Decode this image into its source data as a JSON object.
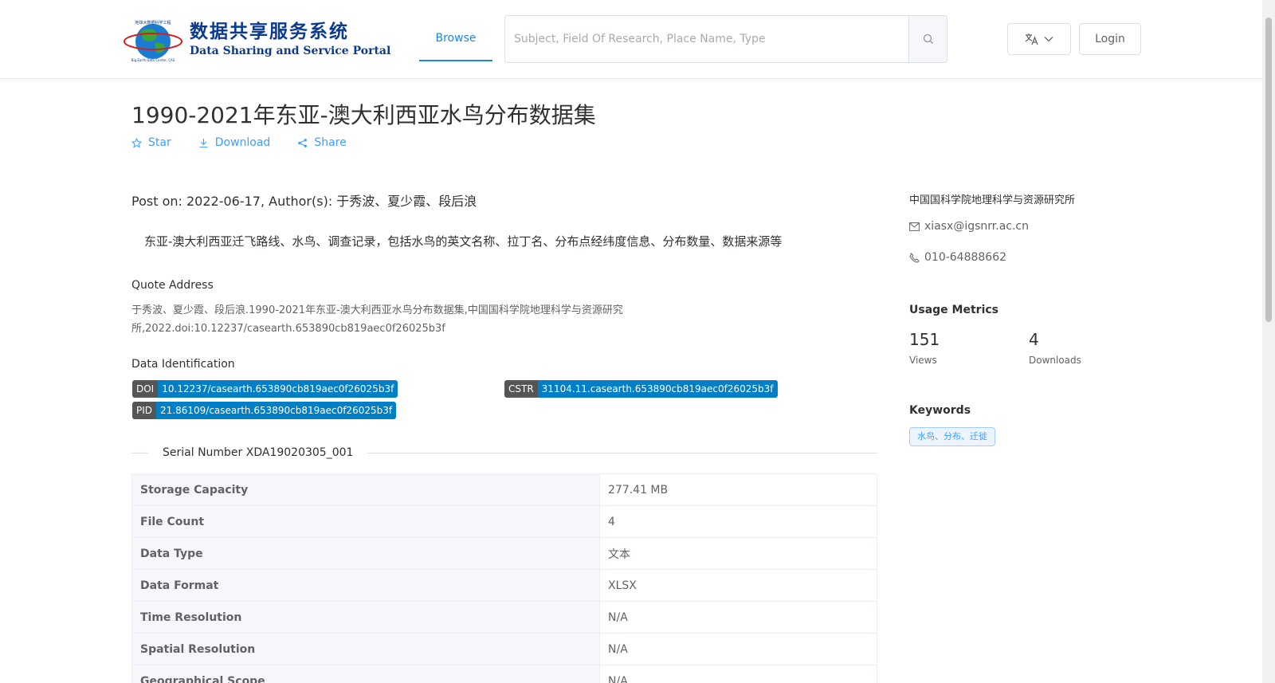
{
  "header": {
    "logo_cn": "数据共享服务系统",
    "logo_en": "Data Sharing and Service Portal",
    "nav_browse": "Browse",
    "search_placeholder": "Subject, Field Of Research, Place Name, Type",
    "login_label": "Login"
  },
  "dataset": {
    "title": "1990-2021年东亚-澳大利西亚水鸟分布数据集",
    "actions": {
      "star": "Star",
      "download": "Download",
      "share": "Share"
    },
    "post_on": "Post on: 2022-06-17, Author(s): 于秀波、夏少霞、段后浪",
    "description": "东亚-澳大利西亚迁飞路线、水鸟、调查记录，包括水鸟的英文名称、拉丁名、分布点经纬度信息、分布数量、数据来源等",
    "quote_label": "Quote Address",
    "quote_text": "于秀波、夏少霞、段后浪.1990-2021年东亚-澳大利西亚水鸟分布数据集,中国国科学院地理科学与资源研究所,2022.doi:10.12237/casearth.653890cb819aec0f26025b3f",
    "identification_label": "Data Identification",
    "identifiers": {
      "doi_key": "DOI",
      "doi_val": "10.12237/casearth.653890cb819aec0f26025b3f",
      "cstr_key": "CSTR",
      "cstr_val": "31104.11.casearth.653890cb819aec0f26025b3f",
      "pid_key": "PID",
      "pid_val": "21.86109/casearth.653890cb819aec0f26025b3f"
    },
    "serial_number": "Serial Number XDA19020305_001",
    "table": [
      {
        "key": "Storage Capacity",
        "value": "277.41 MB"
      },
      {
        "key": "File Count",
        "value": "4"
      },
      {
        "key": "Data Type",
        "value": "文本"
      },
      {
        "key": "Data Format",
        "value": "XLSX"
      },
      {
        "key": "Time Resolution",
        "value": "N/A"
      },
      {
        "key": "Spatial Resolution",
        "value": "N/A"
      },
      {
        "key": "Geographical Scope",
        "value": "N/A"
      }
    ]
  },
  "sidebar": {
    "organization": "中国国科学院地理科学与资源研究所",
    "email": "xiasx@igsnrr.ac.cn",
    "phone": "010-64888662",
    "usage_heading": "Usage Metrics",
    "views_count": "151",
    "views_label": "Views",
    "downloads_count": "4",
    "downloads_label": "Downloads",
    "keywords_heading": "Keywords",
    "keyword": "水鸟、分布、迁徙"
  },
  "colors": {
    "accent": "#409eff",
    "nav_active": "#1e88e5",
    "tag_key_bg": "#555555",
    "tag_val_bg": "#007ec6"
  }
}
